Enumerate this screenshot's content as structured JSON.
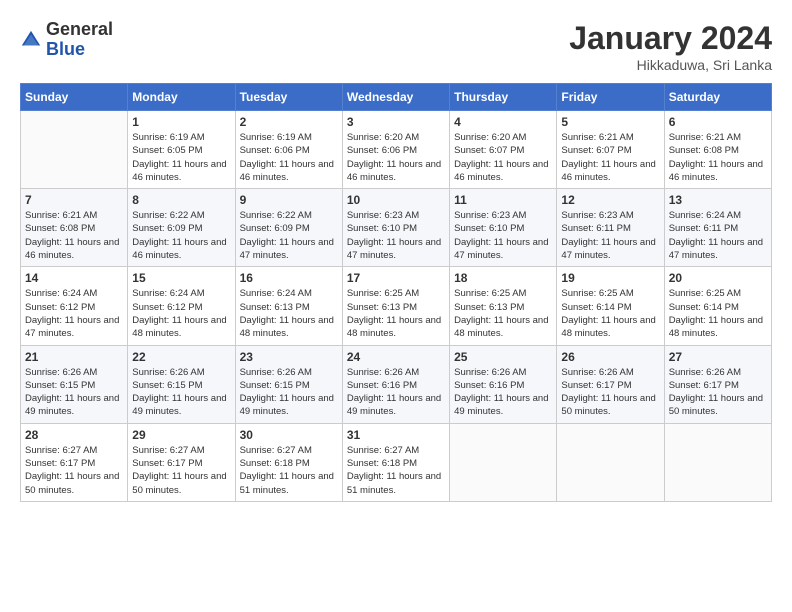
{
  "header": {
    "logo_general": "General",
    "logo_blue": "Blue",
    "month": "January 2024",
    "location": "Hikkaduwa, Sri Lanka"
  },
  "weekdays": [
    "Sunday",
    "Monday",
    "Tuesday",
    "Wednesday",
    "Thursday",
    "Friday",
    "Saturday"
  ],
  "weeks": [
    [
      {
        "day": "",
        "info": ""
      },
      {
        "day": "1",
        "info": "Sunrise: 6:19 AM\nSunset: 6:05 PM\nDaylight: 11 hours and 46 minutes."
      },
      {
        "day": "2",
        "info": "Sunrise: 6:19 AM\nSunset: 6:06 PM\nDaylight: 11 hours and 46 minutes."
      },
      {
        "day": "3",
        "info": "Sunrise: 6:20 AM\nSunset: 6:06 PM\nDaylight: 11 hours and 46 minutes."
      },
      {
        "day": "4",
        "info": "Sunrise: 6:20 AM\nSunset: 6:07 PM\nDaylight: 11 hours and 46 minutes."
      },
      {
        "day": "5",
        "info": "Sunrise: 6:21 AM\nSunset: 6:07 PM\nDaylight: 11 hours and 46 minutes."
      },
      {
        "day": "6",
        "info": "Sunrise: 6:21 AM\nSunset: 6:08 PM\nDaylight: 11 hours and 46 minutes."
      }
    ],
    [
      {
        "day": "7",
        "info": "Sunrise: 6:21 AM\nSunset: 6:08 PM\nDaylight: 11 hours and 46 minutes."
      },
      {
        "day": "8",
        "info": "Sunrise: 6:22 AM\nSunset: 6:09 PM\nDaylight: 11 hours and 46 minutes."
      },
      {
        "day": "9",
        "info": "Sunrise: 6:22 AM\nSunset: 6:09 PM\nDaylight: 11 hours and 47 minutes."
      },
      {
        "day": "10",
        "info": "Sunrise: 6:23 AM\nSunset: 6:10 PM\nDaylight: 11 hours and 47 minutes."
      },
      {
        "day": "11",
        "info": "Sunrise: 6:23 AM\nSunset: 6:10 PM\nDaylight: 11 hours and 47 minutes."
      },
      {
        "day": "12",
        "info": "Sunrise: 6:23 AM\nSunset: 6:11 PM\nDaylight: 11 hours and 47 minutes."
      },
      {
        "day": "13",
        "info": "Sunrise: 6:24 AM\nSunset: 6:11 PM\nDaylight: 11 hours and 47 minutes."
      }
    ],
    [
      {
        "day": "14",
        "info": "Sunrise: 6:24 AM\nSunset: 6:12 PM\nDaylight: 11 hours and 47 minutes."
      },
      {
        "day": "15",
        "info": "Sunrise: 6:24 AM\nSunset: 6:12 PM\nDaylight: 11 hours and 48 minutes."
      },
      {
        "day": "16",
        "info": "Sunrise: 6:24 AM\nSunset: 6:13 PM\nDaylight: 11 hours and 48 minutes."
      },
      {
        "day": "17",
        "info": "Sunrise: 6:25 AM\nSunset: 6:13 PM\nDaylight: 11 hours and 48 minutes."
      },
      {
        "day": "18",
        "info": "Sunrise: 6:25 AM\nSunset: 6:13 PM\nDaylight: 11 hours and 48 minutes."
      },
      {
        "day": "19",
        "info": "Sunrise: 6:25 AM\nSunset: 6:14 PM\nDaylight: 11 hours and 48 minutes."
      },
      {
        "day": "20",
        "info": "Sunrise: 6:25 AM\nSunset: 6:14 PM\nDaylight: 11 hours and 48 minutes."
      }
    ],
    [
      {
        "day": "21",
        "info": "Sunrise: 6:26 AM\nSunset: 6:15 PM\nDaylight: 11 hours and 49 minutes."
      },
      {
        "day": "22",
        "info": "Sunrise: 6:26 AM\nSunset: 6:15 PM\nDaylight: 11 hours and 49 minutes."
      },
      {
        "day": "23",
        "info": "Sunrise: 6:26 AM\nSunset: 6:15 PM\nDaylight: 11 hours and 49 minutes."
      },
      {
        "day": "24",
        "info": "Sunrise: 6:26 AM\nSunset: 6:16 PM\nDaylight: 11 hours and 49 minutes."
      },
      {
        "day": "25",
        "info": "Sunrise: 6:26 AM\nSunset: 6:16 PM\nDaylight: 11 hours and 49 minutes."
      },
      {
        "day": "26",
        "info": "Sunrise: 6:26 AM\nSunset: 6:17 PM\nDaylight: 11 hours and 50 minutes."
      },
      {
        "day": "27",
        "info": "Sunrise: 6:26 AM\nSunset: 6:17 PM\nDaylight: 11 hours and 50 minutes."
      }
    ],
    [
      {
        "day": "28",
        "info": "Sunrise: 6:27 AM\nSunset: 6:17 PM\nDaylight: 11 hours and 50 minutes."
      },
      {
        "day": "29",
        "info": "Sunrise: 6:27 AM\nSunset: 6:17 PM\nDaylight: 11 hours and 50 minutes."
      },
      {
        "day": "30",
        "info": "Sunrise: 6:27 AM\nSunset: 6:18 PM\nDaylight: 11 hours and 51 minutes."
      },
      {
        "day": "31",
        "info": "Sunrise: 6:27 AM\nSunset: 6:18 PM\nDaylight: 11 hours and 51 minutes."
      },
      {
        "day": "",
        "info": ""
      },
      {
        "day": "",
        "info": ""
      },
      {
        "day": "",
        "info": ""
      }
    ]
  ]
}
